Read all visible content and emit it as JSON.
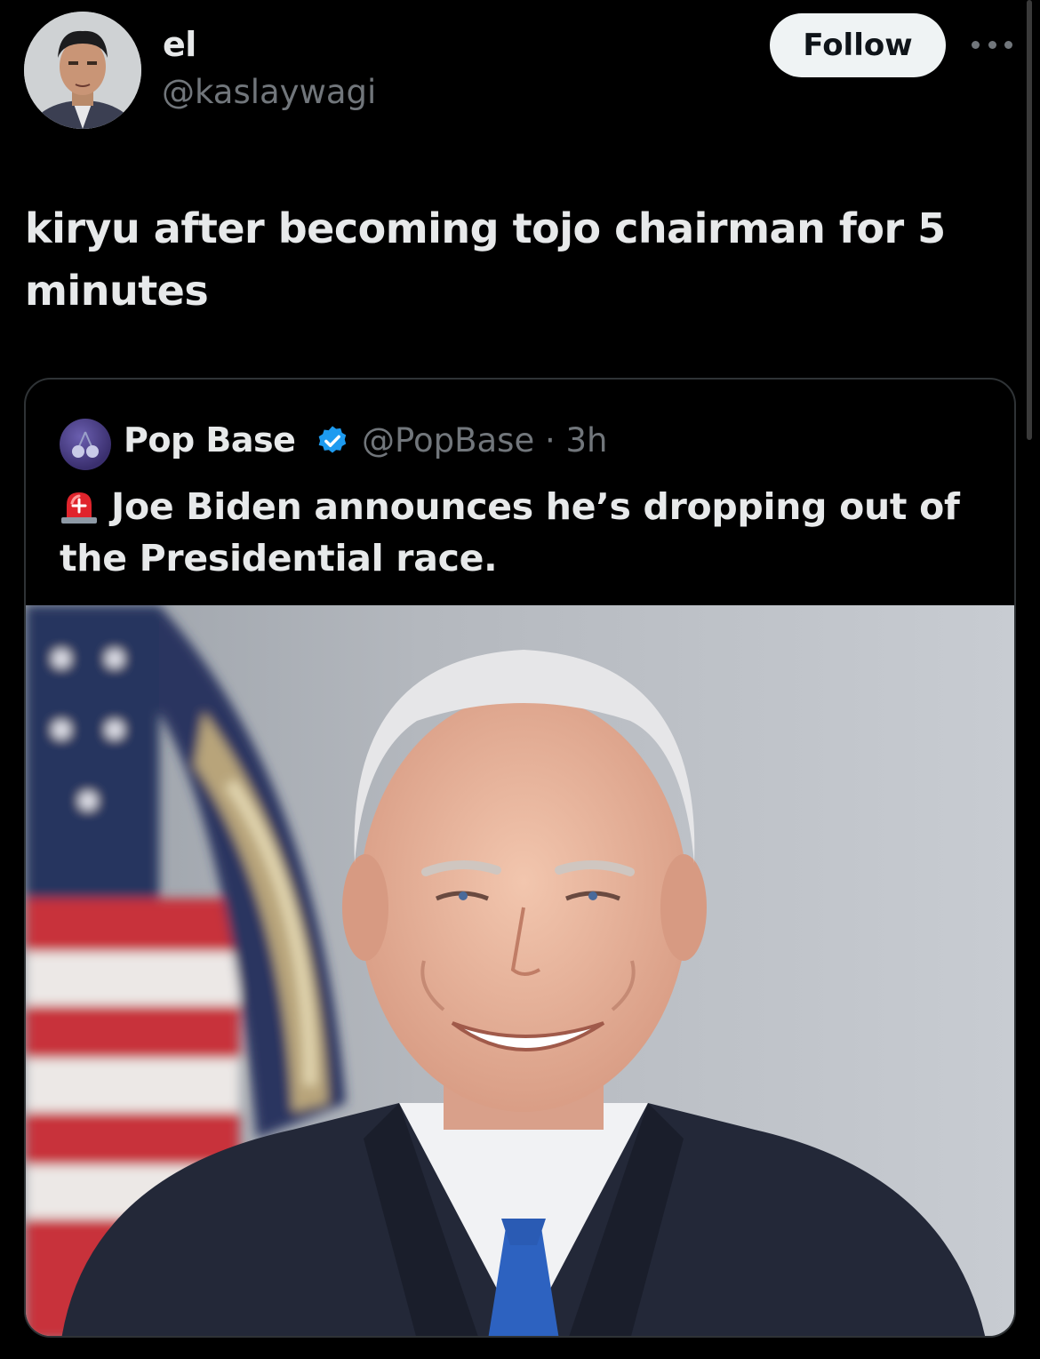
{
  "tweet": {
    "author": {
      "display_name": "el",
      "handle": "@kaslaywagi"
    },
    "follow_label": "Follow",
    "text": "kiryu after becoming tojo chairman for 5 minutes"
  },
  "quoted": {
    "author": {
      "display_name": "Pop Base",
      "handle": "@PopBase",
      "time": "3h"
    },
    "text": "Joe Biden announces he’s dropping out of the Presidential race.",
    "icons": [
      "siren-icon",
      "verified-badge-icon"
    ]
  },
  "colors": {
    "background": "#000000",
    "primary_text": "#e7e9ea",
    "secondary_text": "#71767b",
    "follow_button_bg": "#eff3f4",
    "verified_blue": "#1d9bf0",
    "card_border": "#2f3336"
  }
}
